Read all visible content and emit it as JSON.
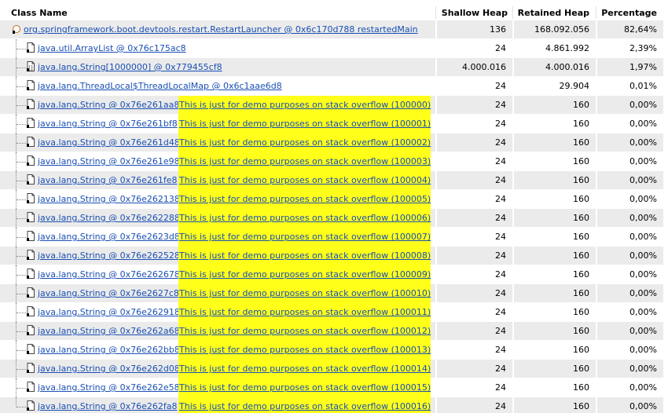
{
  "columns": {
    "class_name": "Class Name",
    "shallow_heap": "Shallow Heap",
    "retained_heap": "Retained Heap",
    "percentage": "Percentage"
  },
  "rows": [
    {
      "label": "org.springframework.boot.devtools.restart.RestartLauncher @ 0x6c170d788 restartedMain",
      "note": "",
      "shallow": "136",
      "retained": "168.092.056",
      "pct": "82,64%",
      "icon": "thread-icon"
    },
    {
      "label": "java.util.ArrayList @ 0x76c175ac8",
      "note": "",
      "shallow": "24",
      "retained": "4.861.992",
      "pct": "2,39%",
      "icon": "object-icon"
    },
    {
      "label": "java.lang.String[1000000] @ 0x779455cf8",
      "note": "",
      "shallow": "4.000.016",
      "retained": "4.000.016",
      "pct": "1,97%",
      "icon": "array-icon"
    },
    {
      "label": "java.lang.ThreadLocal$ThreadLocalMap @ 0x6c1aae6d8",
      "note": "",
      "shallow": "24",
      "retained": "29.904",
      "pct": "0,01%",
      "icon": "object-icon"
    },
    {
      "label": "java.lang.String @ 0x76e261aa8",
      "note": "This is just for demo purposes on stack overflow (100000)",
      "shallow": "24",
      "retained": "160",
      "pct": "0,00%",
      "icon": "object-icon"
    },
    {
      "label": "java.lang.String @ 0x76e261bf8",
      "note": "This is just for demo purposes on stack overflow (100001)",
      "shallow": "24",
      "retained": "160",
      "pct": "0,00%",
      "icon": "object-icon"
    },
    {
      "label": "java.lang.String @ 0x76e261d48",
      "note": "This is just for demo purposes on stack overflow (100002)",
      "shallow": "24",
      "retained": "160",
      "pct": "0,00%",
      "icon": "object-icon"
    },
    {
      "label": "java.lang.String @ 0x76e261e98",
      "note": "This is just for demo purposes on stack overflow (100003)",
      "shallow": "24",
      "retained": "160",
      "pct": "0,00%",
      "icon": "object-icon"
    },
    {
      "label": "java.lang.String @ 0x76e261fe8",
      "note": "This is just for demo purposes on stack overflow (100004)",
      "shallow": "24",
      "retained": "160",
      "pct": "0,00%",
      "icon": "object-icon"
    },
    {
      "label": "java.lang.String @ 0x76e262138",
      "note": "This is just for demo purposes on stack overflow (100005)",
      "shallow": "24",
      "retained": "160",
      "pct": "0,00%",
      "icon": "object-icon"
    },
    {
      "label": "java.lang.String @ 0x76e262288",
      "note": "This is just for demo purposes on stack overflow (100006)",
      "shallow": "24",
      "retained": "160",
      "pct": "0,00%",
      "icon": "object-icon"
    },
    {
      "label": "java.lang.String @ 0x76e2623d8",
      "note": "This is just for demo purposes on stack overflow (100007)",
      "shallow": "24",
      "retained": "160",
      "pct": "0,00%",
      "icon": "object-icon"
    },
    {
      "label": "java.lang.String @ 0x76e262528",
      "note": "This is just for demo purposes on stack overflow (100008)",
      "shallow": "24",
      "retained": "160",
      "pct": "0,00%",
      "icon": "object-icon"
    },
    {
      "label": "java.lang.String @ 0x76e262678",
      "note": "This is just for demo purposes on stack overflow (100009)",
      "shallow": "24",
      "retained": "160",
      "pct": "0,00%",
      "icon": "object-icon"
    },
    {
      "label": "java.lang.String @ 0x76e2627c8",
      "note": "This is just for demo purposes on stack overflow (100010)",
      "shallow": "24",
      "retained": "160",
      "pct": "0,00%",
      "icon": "object-icon"
    },
    {
      "label": "java.lang.String @ 0x76e262918",
      "note": "This is just for demo purposes on stack overflow (100011)",
      "shallow": "24",
      "retained": "160",
      "pct": "0,00%",
      "icon": "object-icon"
    },
    {
      "label": "java.lang.String @ 0x76e262a68",
      "note": "This is just for demo purposes on stack overflow (100012)",
      "shallow": "24",
      "retained": "160",
      "pct": "0,00%",
      "icon": "object-icon"
    },
    {
      "label": "java.lang.String @ 0x76e262bb8",
      "note": "This is just for demo purposes on stack overflow (100013)",
      "shallow": "24",
      "retained": "160",
      "pct": "0,00%",
      "icon": "object-icon"
    },
    {
      "label": "java.lang.String @ 0x76e262d08",
      "note": "This is just for demo purposes on stack overflow (100014)",
      "shallow": "24",
      "retained": "160",
      "pct": "0,00%",
      "icon": "object-icon"
    },
    {
      "label": "java.lang.String @ 0x76e262e58",
      "note": "This is just for demo purposes on stack overflow (100015)",
      "shallow": "24",
      "retained": "160",
      "pct": "0,00%",
      "icon": "object-icon"
    },
    {
      "label": "java.lang.String @ 0x76e262fa8",
      "note": "This is just for demo purposes on stack overflow (100016)",
      "shallow": "24",
      "retained": "160",
      "pct": "0,00%",
      "icon": "object-icon"
    }
  ],
  "colors": {
    "link": "#1a4fb4",
    "highlight": "#ffff1a",
    "row_alt": "#ebebeb"
  }
}
